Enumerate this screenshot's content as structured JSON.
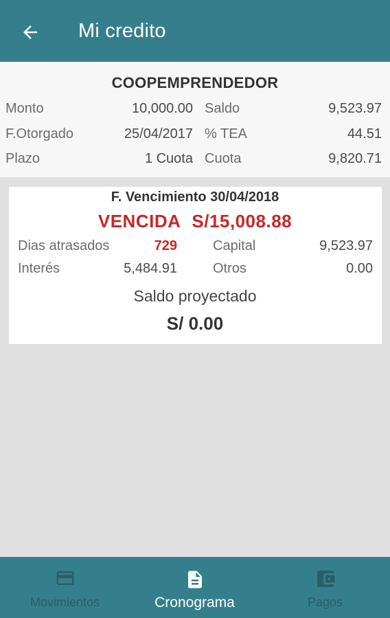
{
  "appbar": {
    "title": "Mi credito",
    "back_icon": "arrow-left-icon"
  },
  "summary": {
    "entity": "COOPEMPRENDEDOR",
    "rows": [
      {
        "label1": "Monto",
        "value1": "10,000.00",
        "label2": "Saldo",
        "value2": "9,523.97"
      },
      {
        "label1": "F.Otorgado",
        "value1": "25/04/2017",
        "label2": "% TEA",
        "value2": "44.51"
      },
      {
        "label1": "Plazo",
        "value1": "1 Cuota",
        "label2": "Cuota",
        "value2": "9,820.71"
      }
    ]
  },
  "card": {
    "due_date": "F. Vencimiento 30/04/2018",
    "status": "VENCIDA",
    "amount": "S/15,008.88",
    "rows": [
      {
        "label1": "Dias atrasados",
        "value1": "729",
        "label2": "Capital",
        "value2": "9,523.97"
      },
      {
        "label1": "Interés",
        "value1": "5,484.91",
        "label2": "Otros",
        "value2": "0.00"
      }
    ],
    "projected_label": "Saldo proyectado",
    "projected_value": "S/ 0.00"
  },
  "bottom_nav": {
    "items": [
      {
        "label": "Movimientos",
        "icon": "credit-card-icon",
        "active": false
      },
      {
        "label": "Cronograma",
        "icon": "document-icon",
        "active": true
      },
      {
        "label": "Pagos",
        "icon": "wallet-icon",
        "active": false
      }
    ]
  },
  "colors": {
    "primary": "#357f8c",
    "alert": "#c62828",
    "background": "#e0e0e0"
  }
}
